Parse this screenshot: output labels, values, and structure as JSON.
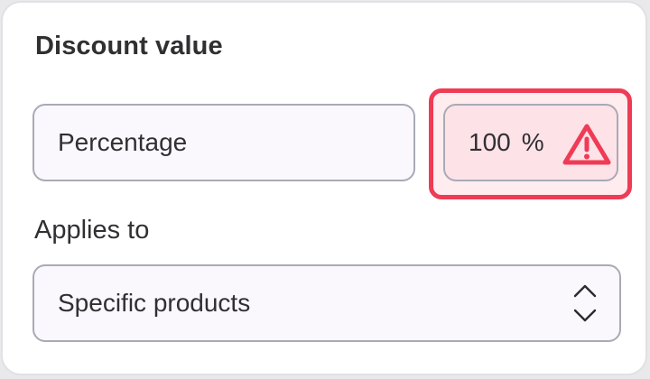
{
  "discount": {
    "section_title": "Discount value",
    "type_select": {
      "value": "Percentage"
    },
    "value_field": {
      "value": "100",
      "unit": "%",
      "state": "error",
      "error_color": "#ef3b55",
      "icon": "warning-triangle-icon"
    }
  },
  "applies_to": {
    "label": "Applies to",
    "select": {
      "value": "Specific products",
      "icon": "chevron-up-down-icon"
    }
  }
}
